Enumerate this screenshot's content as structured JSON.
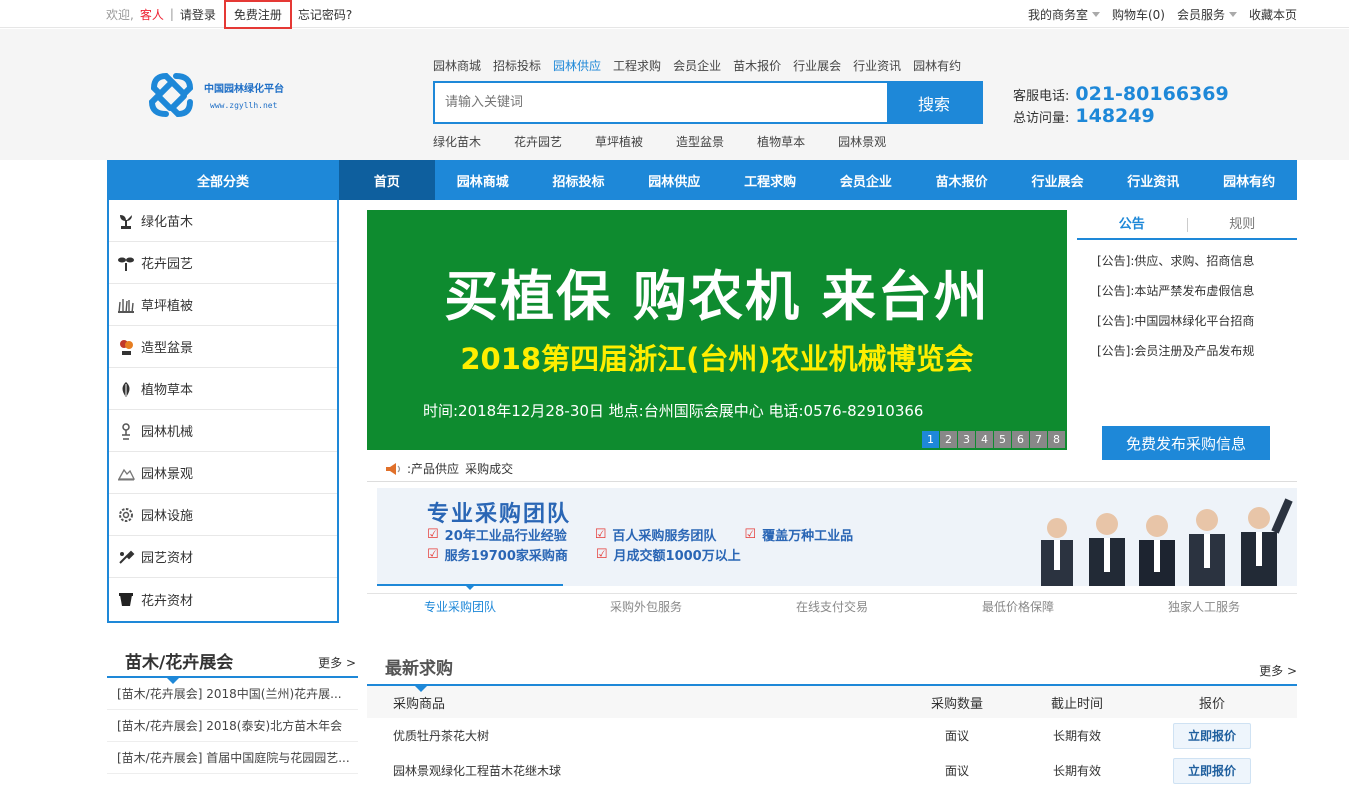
{
  "topbar": {
    "welcome": "欢迎,",
    "guest": "客人",
    "sep": "|",
    "login": "请登录",
    "register": "免费注册",
    "forgot": "忘记密码?",
    "my_office": "我的商务室",
    "cart": "购物车(0)",
    "member_service": "会员服务",
    "favorite": "收藏本页"
  },
  "logo": {
    "name": "中国园林绿化平台",
    "domain": "www.zgyllh.net"
  },
  "header_nav": [
    "园林商城",
    "招标投标",
    "园林供应",
    "工程求购",
    "会员企业",
    "苗木报价",
    "行业展会",
    "行业资讯",
    "园林有约"
  ],
  "search": {
    "placeholder": "请输入关键词",
    "button": "搜索"
  },
  "hot_words": [
    "绿化苗木",
    "花卉园艺",
    "草坪植被",
    "造型盆景",
    "植物草本",
    "园林景观"
  ],
  "service": {
    "phone_label": "客服电话:",
    "phone": "021-80166369",
    "visits_label": "总访问量:",
    "visits": "148249"
  },
  "main_nav": {
    "all": "全部分类",
    "items": [
      "首页",
      "园林商城",
      "招标投标",
      "园林供应",
      "工程求购",
      "会员企业",
      "苗木报价",
      "行业展会",
      "行业资讯",
      "园林有约"
    ]
  },
  "categories": [
    "绿化苗木",
    "花卉园艺",
    "草坪植被",
    "造型盆景",
    "植物草本",
    "园林机械",
    "园林景观",
    "园林设施",
    "园艺资材",
    "花卉资材"
  ],
  "banner": {
    "line1": "买植保 购农机 来台州",
    "line2": "2018第四届浙江(台州)农业机械博览会",
    "line3": "时间:2018年12月28-30日   地点:台州国际会展中心   电话:0576-82910366",
    "pages": [
      "1",
      "2",
      "3",
      "4",
      "5",
      "6",
      "7",
      "8"
    ]
  },
  "notice": {
    "tabs": [
      "公告",
      "规则"
    ],
    "items": [
      "[公告]:供应、求购、招商信息",
      "[公告]:本站严禁发布虚假信息",
      "[公告]:中国园林绿化平台招商",
      "[公告]:会员注册及产品发布规"
    ],
    "publish_button": "免费发布采购信息"
  },
  "ticker": {
    "a": "产品供应",
    "b": "采购成交"
  },
  "promo": {
    "title": "专业采购团队",
    "points": [
      [
        "20年工业品行业经验",
        "百人采购服务团队",
        "覆盖万种工业品"
      ],
      [
        "服务19700家采购商",
        "月成交额1000万以上"
      ]
    ],
    "tabs": [
      "专业采购团队",
      "采购外包服务",
      "在线支付交易",
      "最低价格保障",
      "独家人工服务"
    ]
  },
  "expo": {
    "title": "苗木/花卉展会",
    "more": "更多 >",
    "items": [
      "[苗木/花卉展会] 2018中国(兰州)花卉展...",
      "[苗木/花卉展会] 2018(泰安)北方苗木年会",
      "[苗木/花卉展会] 首届中国庭院与花园园艺..."
    ]
  },
  "latest": {
    "title": "最新求购",
    "more": "更多 >",
    "headers": [
      "采购商品",
      "采购数量",
      "截止时间",
      "报价"
    ],
    "rows": [
      {
        "product": "优质牡丹茶花大树",
        "qty": "面议",
        "deadline": "长期有效",
        "action": "立即报价"
      },
      {
        "product": "园林景观绿化工程苗木花继木球",
        "qty": "面议",
        "deadline": "长期有效",
        "action": "立即报价"
      }
    ]
  }
}
